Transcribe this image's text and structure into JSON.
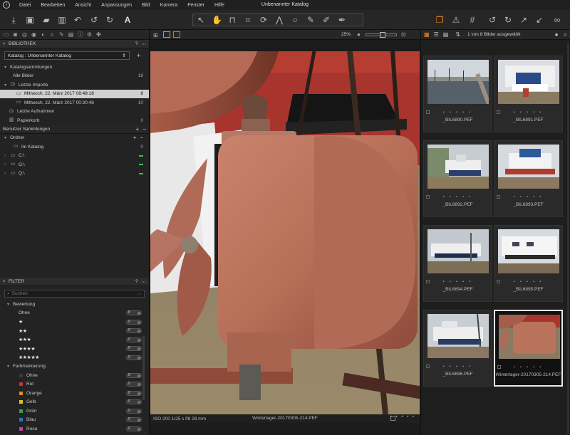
{
  "app": {
    "window_title": "Unbenannter Katalog",
    "menu": [
      "Datei",
      "Bearbeiten",
      "Ansicht",
      "Anpassungen",
      "Bild",
      "Kamera",
      "Fenster",
      "Hilfe"
    ]
  },
  "library": {
    "header": "BIBLIOTHEK",
    "catalog_select": "Katalog : Unbenannter Katalog",
    "collections_header": "Katalogsammlungen",
    "all_images": {
      "label": "Alle Bilder",
      "count": "18"
    },
    "recent_imports": {
      "label": "Letzte Importe",
      "items": [
        {
          "label": "Mittwoch, 22. März 2017 08:48:18",
          "count": "8"
        },
        {
          "label": "Mittwoch, 22. März 2017 00:30:48",
          "count": "10"
        }
      ]
    },
    "recent_captures": "Letzte Aufnahmen",
    "trash": {
      "label": "Papierkorb",
      "count": "0"
    },
    "user_collections": "Benutzer Sammlungen",
    "folders": {
      "label": "Ordner",
      "in_catalog": {
        "label": "Im Katalog",
        "count": "0"
      },
      "drives": [
        "C:\\",
        "G:\\",
        "Q:\\"
      ]
    }
  },
  "filter": {
    "header": "FILTER",
    "search_placeholder": "Suchen",
    "rating": {
      "label": "Bewertung",
      "rows": [
        {
          "label": "Ohne",
          "count": "8"
        },
        {
          "stars": "★",
          "count": "0"
        },
        {
          "stars": "★★",
          "count": "0"
        },
        {
          "stars": "★★★",
          "count": "0"
        },
        {
          "stars": "★★★★",
          "count": "0"
        },
        {
          "stars": "★★★★★",
          "count": "0"
        }
      ]
    },
    "color_label": {
      "label": "Farbmarkierung",
      "rows": [
        {
          "label": "Ohne",
          "count": "8",
          "color": "#3a3a3a"
        },
        {
          "label": "Rot",
          "count": "0",
          "color": "#d03030"
        },
        {
          "label": "Orange",
          "count": "0",
          "color": "#e08a20"
        },
        {
          "label": "Gelb",
          "count": "0",
          "color": "#d8c820"
        },
        {
          "label": "Grün",
          "count": "0",
          "color": "#3aa040"
        },
        {
          "label": "Blau",
          "count": "0",
          "color": "#2f6fd0"
        },
        {
          "label": "Rosa",
          "count": "0",
          "color": "#c040a0"
        }
      ]
    }
  },
  "viewer": {
    "zoom": "25%",
    "exif": "ISO 200  1/25 s  f/8  28 mm",
    "filename": "Winterlager-20170305-214.PEF"
  },
  "browser": {
    "count_text": "1 von 8 Bilder ausgewählt",
    "thumbnails": [
      {
        "name": "_BIL6890.PEF"
      },
      {
        "name": "_BIL6891.PEF"
      },
      {
        "name": "_BIL6892.PEF"
      },
      {
        "name": "_BIL6893.PEF"
      },
      {
        "name": "_BIL6894.PEF"
      },
      {
        "name": "_BIL6895.PEF"
      },
      {
        "name": "_BIL6896.PEF"
      },
      {
        "name": "Winterlager-20170305-214.PEF"
      }
    ],
    "rating_dots": "• • • • •"
  },
  "colors": {
    "accent": "#f08a24",
    "selection": "#cfcfcf",
    "drive_ok": "#3ac14b"
  }
}
